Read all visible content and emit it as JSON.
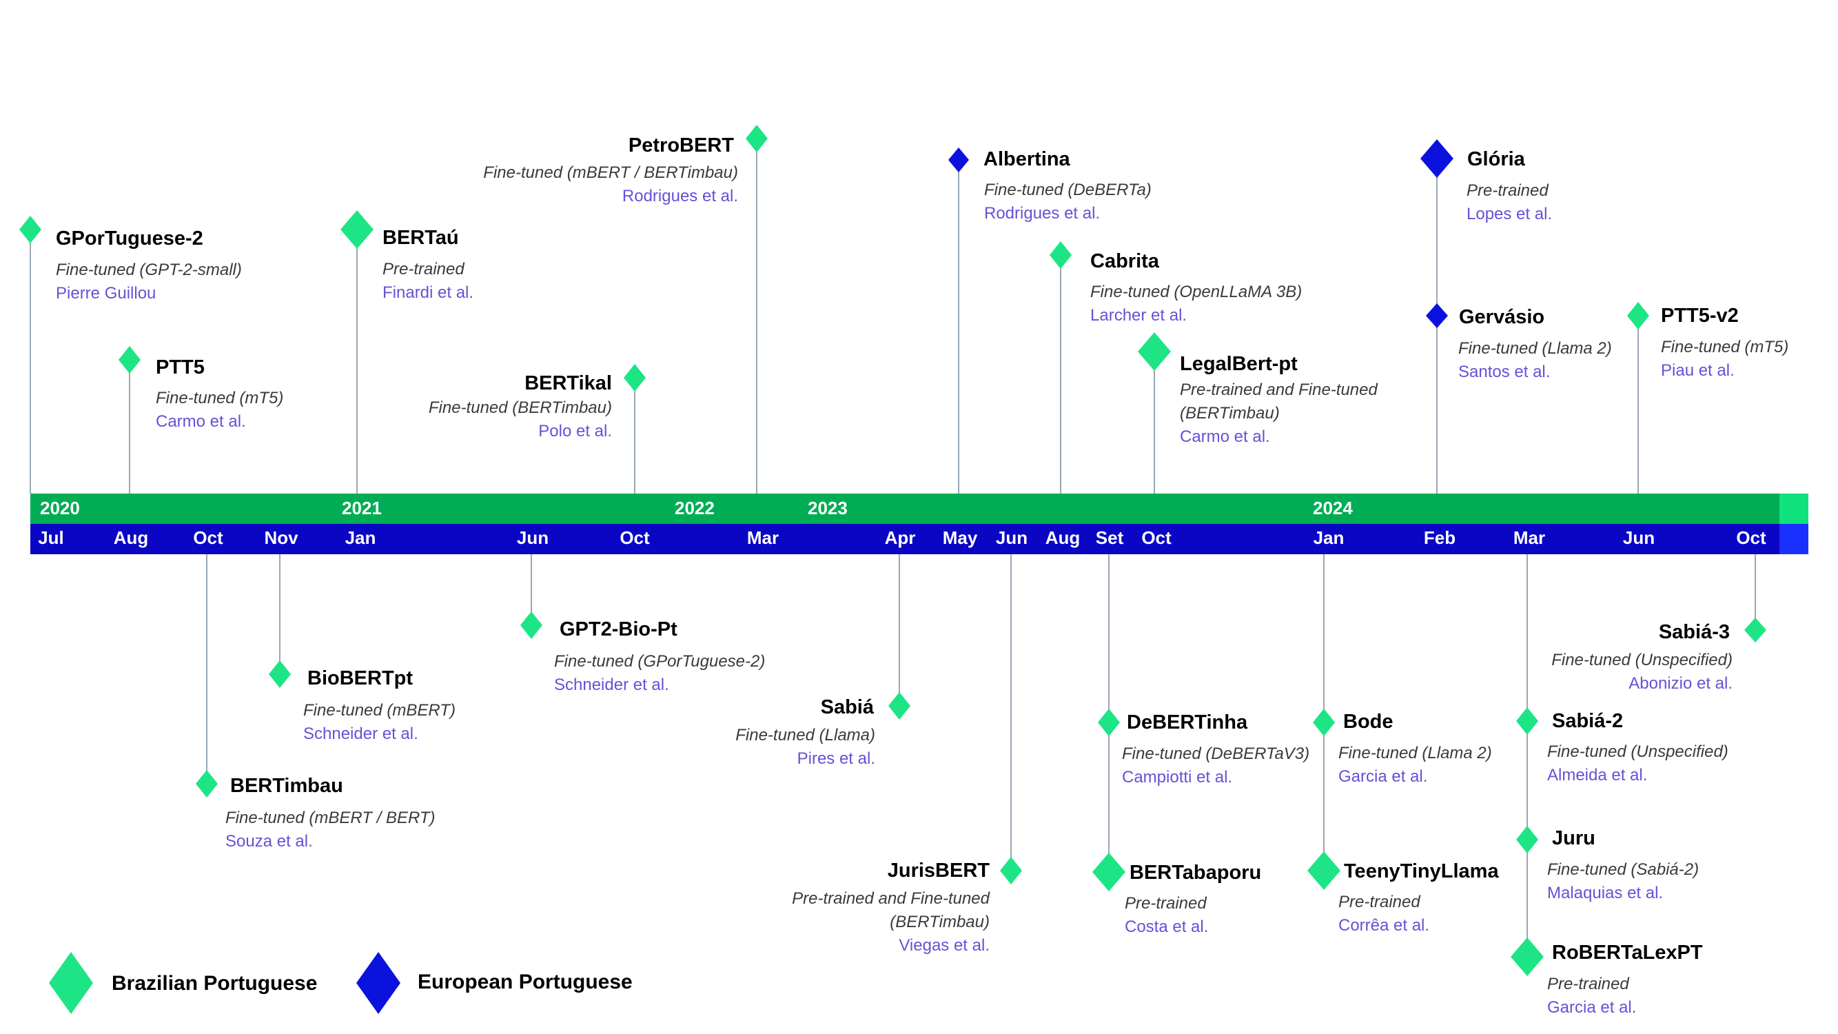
{
  "colors": {
    "brazilian": "#1de585",
    "european": "#0b12dd",
    "year_bar": "#00ad55",
    "year_bar_end": "#0fe27d",
    "month_bar": "#0a06c4",
    "month_bar_end": "#1a30ff",
    "connector": "#9aa7b5",
    "author": "#6a4fd6"
  },
  "years": [
    "2020",
    "2021",
    "2022",
    "2023",
    "2024"
  ],
  "months": [
    "Jul",
    "Aug",
    "Oct",
    "Nov",
    "Jan",
    "Jun",
    "Oct",
    "Mar",
    "Apr",
    "May",
    "Jun",
    "Aug",
    "Set",
    "Oct",
    "Jan",
    "Feb",
    "Mar",
    "Jun",
    "Oct"
  ],
  "models": [
    {
      "name": "GPorTuguese-2",
      "type": "Fine-tuned (GPT-2-small)",
      "authors": "Pierre Guillou",
      "variant": "Brazilian Portuguese"
    },
    {
      "name": "PTT5",
      "type": "Fine-tuned (mT5)",
      "authors": "Carmo et al.",
      "variant": "Brazilian Portuguese"
    },
    {
      "name": "BERTaú",
      "type": "Pre-trained",
      "authors": "Finardi et al.",
      "variant": "Brazilian Portuguese"
    },
    {
      "name": "BERTikal",
      "type": "Fine-tuned (BERTimbau)",
      "authors": "Polo et al.",
      "variant": "Brazilian Portuguese"
    },
    {
      "name": "PetroBERT",
      "type": "Fine-tuned (mBERT / BERTimbau)",
      "authors": "Rodrigues et al.",
      "variant": "Brazilian Portuguese"
    },
    {
      "name": "Albertina",
      "type": "Fine-tuned (DeBERTa)",
      "authors": "Rodrigues et al.",
      "variant": "European Portuguese"
    },
    {
      "name": "Cabrita",
      "type": "Fine-tuned (OpenLLaMA 3B)",
      "authors": "Larcher et al.",
      "variant": "Brazilian Portuguese"
    },
    {
      "name": "LegalBert-pt",
      "type": "Pre-trained and Fine-tuned (BERTimbau)",
      "authors": "Carmo et al.",
      "variant": "Brazilian Portuguese"
    },
    {
      "name": "Glória",
      "type": "Pre-trained",
      "authors": "Lopes et al.",
      "variant": "European Portuguese"
    },
    {
      "name": "Gervásio",
      "type": "Fine-tuned (Llama 2)",
      "authors": "Santos et al.",
      "variant": "European Portuguese"
    },
    {
      "name": "PTT5-v2",
      "type": "Fine-tuned (mT5)",
      "authors": "Piau et al.",
      "variant": "Brazilian Portuguese"
    },
    {
      "name": "BioBERTpt",
      "type": "Fine-tuned (mBERT)",
      "authors": "Schneider et al.",
      "variant": "Brazilian Portuguese"
    },
    {
      "name": "BERTimbau",
      "type": "Fine-tuned (mBERT / BERT)",
      "authors": "Souza et al.",
      "variant": "Brazilian Portuguese"
    },
    {
      "name": "GPT2-Bio-Pt",
      "type": "Fine-tuned (GPorTuguese-2)",
      "authors": "Schneider et al.",
      "variant": "Brazilian Portuguese"
    },
    {
      "name": "Sabiá",
      "type": "Fine-tuned (Llama)",
      "authors": "Pires et al.",
      "variant": "Brazilian Portuguese"
    },
    {
      "name": "JurisBERT",
      "type": "Pre-trained and Fine-tuned (BERTimbau)",
      "authors": "Viegas et al.",
      "variant": "Brazilian Portuguese"
    },
    {
      "name": "DeBERTinha",
      "type": "Fine-tuned (DeBERTaV3)",
      "authors": "Campiotti et al.",
      "variant": "Brazilian Portuguese"
    },
    {
      "name": "BERTabaporu",
      "type": "Pre-trained",
      "authors": "Costa et al.",
      "variant": "Brazilian Portuguese"
    },
    {
      "name": "Bode",
      "type": "Fine-tuned (Llama 2)",
      "authors": "Garcia et al.",
      "variant": "Brazilian Portuguese"
    },
    {
      "name": "TeenyTinyLlama",
      "type": "Pre-trained",
      "authors": "Corrêa et al.",
      "variant": "Brazilian Portuguese"
    },
    {
      "name": "Sabiá-3",
      "type": "Fine-tuned (Unspecified)",
      "authors": "Abonizio et al.",
      "variant": "Brazilian Portuguese"
    },
    {
      "name": "Sabiá-2",
      "type": "Fine-tuned (Unspecified)",
      "authors": "Almeida et al.",
      "variant": "Brazilian Portuguese"
    },
    {
      "name": "Juru",
      "type": "Fine-tuned (Sabiá-2)",
      "authors": "Malaquias et al.",
      "variant": "Brazilian Portuguese"
    },
    {
      "name": "RoBERTaLexPT",
      "type": "Pre-trained",
      "authors": "Garcia et al.",
      "variant": "Brazilian Portuguese"
    }
  ],
  "legend": {
    "brazilian": "Brazilian Portuguese",
    "european": "European Portuguese"
  }
}
